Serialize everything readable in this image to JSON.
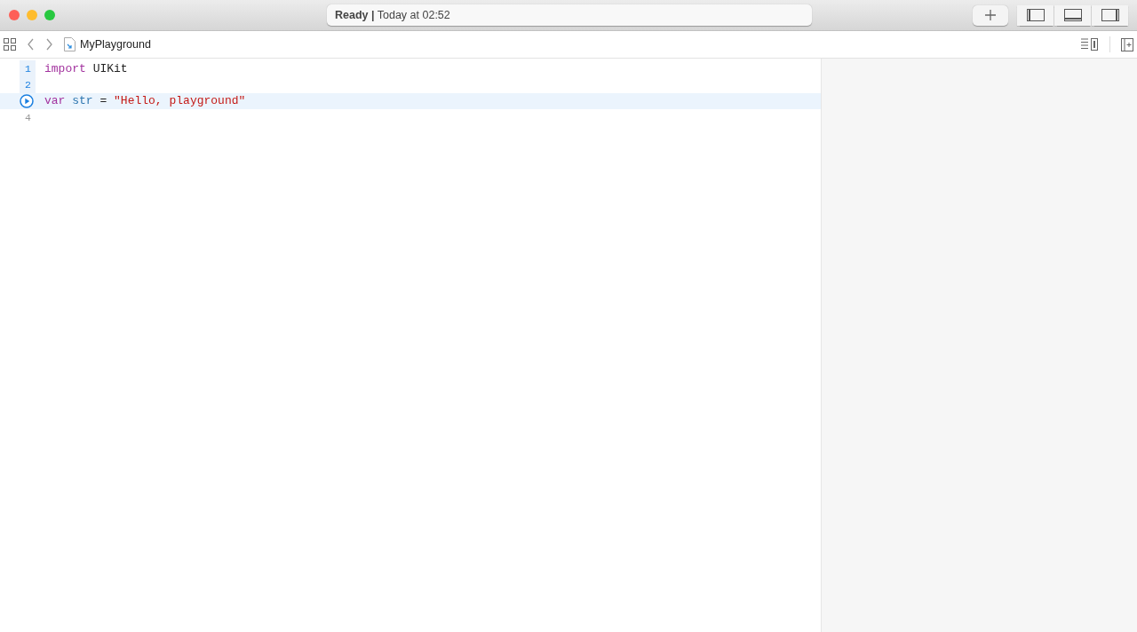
{
  "window": {
    "status": "**Ready |** Today at 02:52"
  },
  "panel_toggles": [
    {
      "on": false
    },
    {
      "on": false
    },
    {
      "on": false
    }
  ],
  "jump_bar": {
    "file": "MyPlayground"
  },
  "editor": {
    "lines": [
      {
        "number": "1",
        "executed": true,
        "selected": false,
        "run_button": false,
        "tokens": [
          {
            "kind": "keyword",
            "text": "import"
          },
          {
            "kind": "plain",
            "text": "UIKit"
          }
        ]
      },
      {
        "number": "2",
        "executed": true,
        "selected": false,
        "run_button": false
      },
      {
        "executed": false,
        "selected": true,
        "run_button": true,
        "tokens": [
          {
            "kind": "keyword",
            "text": "var"
          },
          {
            "kind": "identifier",
            "text": "str"
          },
          {
            "kind": "plain",
            "text": "="
          },
          {
            "kind": "string",
            "text": "\"Hello, playground\""
          }
        ]
      },
      {
        "number": "4",
        "executed": false,
        "selected": false,
        "run_button": false
      }
    ]
  }
}
